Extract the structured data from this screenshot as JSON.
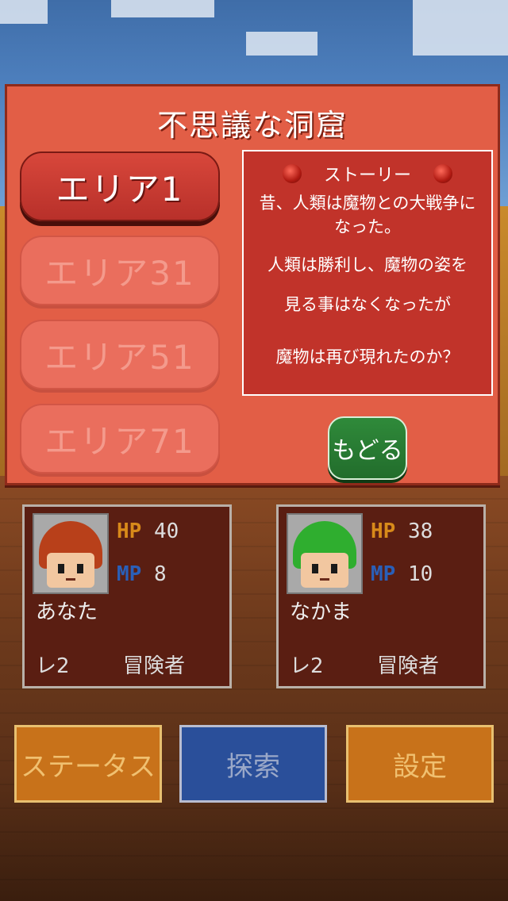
{
  "dialog": {
    "title": "不思議な洞窟",
    "areas": [
      {
        "label": "エリア1",
        "state": "active"
      },
      {
        "label": "エリア31",
        "state": "disabled"
      },
      {
        "label": "エリア51",
        "state": "disabled"
      },
      {
        "label": "エリア71",
        "state": "disabled"
      }
    ],
    "story": {
      "heading": "ストーリー",
      "lines": [
        "昔、人類は魔物との大戦争になった。",
        "人類は勝利し、魔物の姿を",
        "見る事はなくなったが",
        "魔物は再び現れたのか？"
      ]
    },
    "back_label": "もどる"
  },
  "party": [
    {
      "name": "あなた",
      "hp_label": "HP",
      "hp": "40",
      "mp_label": "MP",
      "mp": "8",
      "level": "レ2",
      "job": "冒険者",
      "hair_color": "#b8401a"
    },
    {
      "name": "なかま",
      "hp_label": "HP",
      "hp": "38",
      "mp_label": "MP",
      "mp": "10",
      "level": "レ2",
      "job": "冒険者",
      "hair_color": "#2fae2f"
    }
  ],
  "menu": {
    "status_label": "ステータス",
    "explore_label": "探索",
    "settings_label": "設定"
  },
  "colors": {
    "hp": "#d88a1a",
    "mp": "#2a5fb8"
  }
}
